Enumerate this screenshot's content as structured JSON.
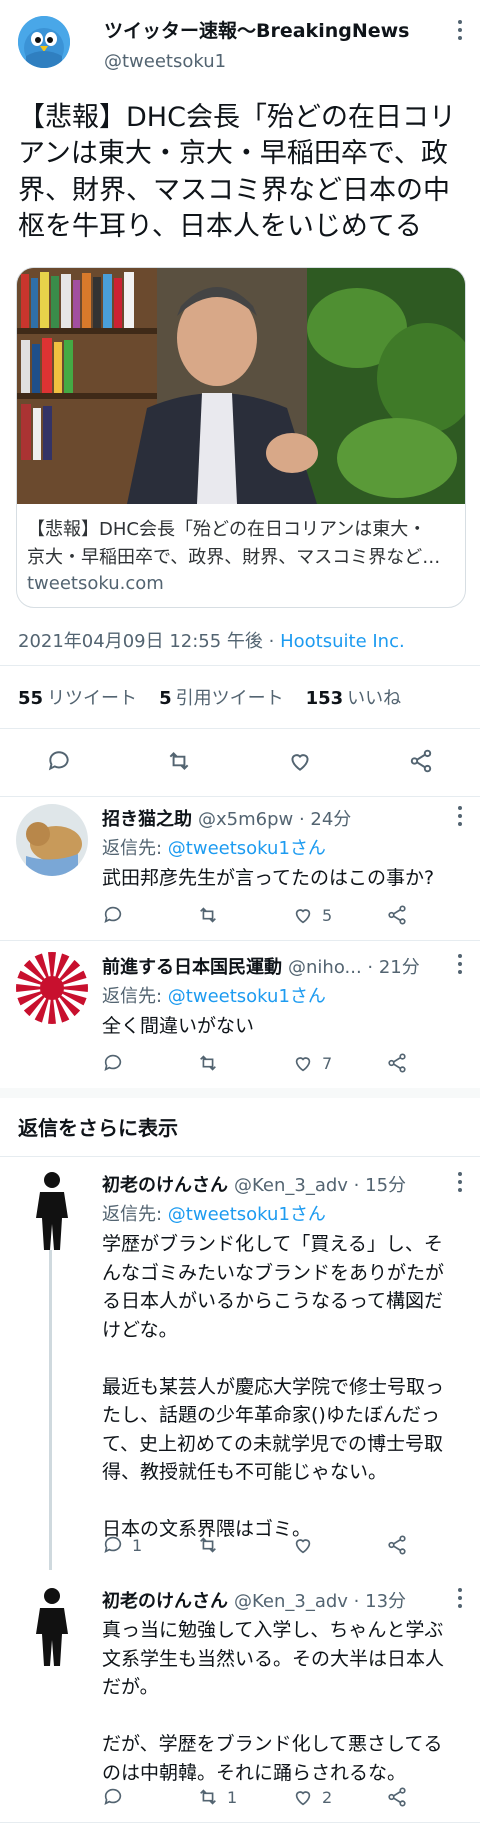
{
  "author": {
    "name": "ツイッター速報〜BreakingNews",
    "handle": "@tweetsoku1"
  },
  "tweet_text": "【悲報】DHC会長「殆どの在日コリアンは東大・京大・早稲田卒で、政界、財界、マスコミ界など日本の中枢を牛耳り、日本人をいじめてる",
  "card": {
    "desc_line1": "【悲報】DHC会長「殆どの在日コリアンは東大・",
    "desc_line2": "京大・早稲田卒で、政界、財界、マスコミ界など…",
    "domain": "tweetsoku.com"
  },
  "meta": {
    "timestamp": "2021年04月09日 12:55 午後 · ",
    "client": "Hootsuite Inc."
  },
  "stats": {
    "retweets_count": "55",
    "retweets_label": "リツイート",
    "quotes_count": "5",
    "quotes_label": "引用ツイート",
    "likes_count": "153",
    "likes_label": "いいね"
  },
  "replies": [
    {
      "name": "招き猫之助",
      "handle": "@x5m6pw · 24分",
      "to_prefix": "返信先: ",
      "to_user": "@tweetsoku1さん",
      "text": "武田邦彦先生が言ってたのはこの事か?",
      "reply_count": "",
      "retweet_count": "",
      "like_count": "5"
    },
    {
      "name": "前進する日本国民運動",
      "handle": "@niho... · 21分",
      "to_prefix": "返信先: ",
      "to_user": "@tweetsoku1さん",
      "text": "全く間違いがない",
      "reply_count": "",
      "retweet_count": "",
      "like_count": "7"
    },
    {
      "name": "初老のけんさん",
      "handle": "@Ken_3_adv · 15分",
      "to_prefix": "返信先: ",
      "to_user": "@tweetsoku1さん",
      "text": "学歴がブランド化して「買える」し、そんなゴミみたいなブランドをありがたがる日本人がいるからこうなるって構図だけどな。\n\n最近も某芸人が慶応大学院で修士号取ったし、話題の少年革命家()ゆたぼんだって、史上初めての未就学児での博士号取得、教授就任も不可能じゃない。\n\n日本の文系界隈はゴミ。",
      "reply_count": "1",
      "retweet_count": "",
      "like_count": ""
    },
    {
      "name": "初老のけんさん",
      "handle": "@Ken_3_adv · 13分",
      "text": "真っ当に勉強して入学し、ちゃんと学ぶ文系学生も当然いる。その大半は日本人だが。\n\nだが、学歴をブランド化して悪さしてるのは中朝韓。それに踊らされるな。",
      "reply_count": "",
      "retweet_count": "1",
      "like_count": "2"
    }
  ],
  "more_replies_label": "返信をさらに表示",
  "colors": {
    "link": "#1d9bf0",
    "muted": "#536471",
    "text": "#0f1419",
    "divider": "#e6ecf0"
  },
  "icons": [
    "bird-avatar-icon",
    "comment-icon",
    "retweet-icon",
    "like-icon",
    "share-icon",
    "more-icon"
  ]
}
